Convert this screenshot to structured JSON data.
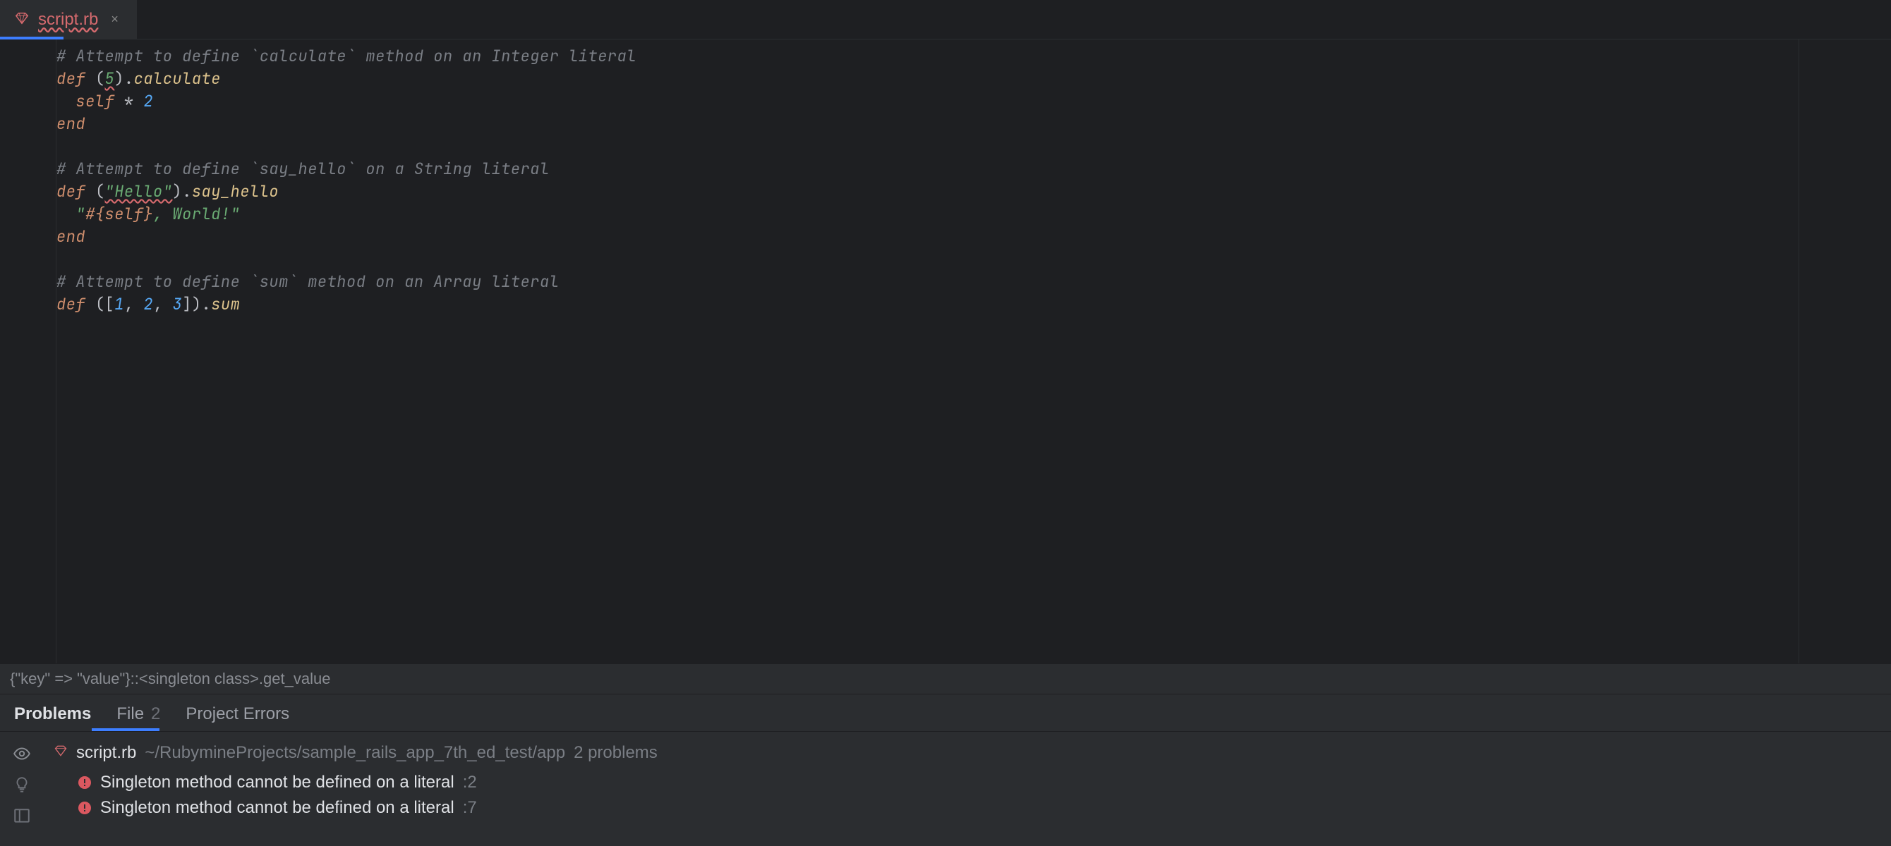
{
  "tab": {
    "filename": "script.rb"
  },
  "code": {
    "lines": [
      {
        "type": "comment",
        "text": "# Attempt to define `calculate` method on an Integer literal"
      },
      {
        "type": "def_int",
        "kw": "def",
        "lparen": "(",
        "num": "5",
        "rparen": ")",
        "dot": ".",
        "method": "calculate"
      },
      {
        "type": "self_mul",
        "self": "self",
        "op": " * ",
        "val": "2"
      },
      {
        "type": "end",
        "text": "end"
      },
      {
        "type": "blank"
      },
      {
        "type": "comment",
        "text": "# Attempt to define `say_hello` on a String literal"
      },
      {
        "type": "def_str",
        "kw": "def",
        "lparen": "(",
        "str": "\"Hello\"",
        "rparen": ")",
        "dot": ".",
        "method": "say_hello"
      },
      {
        "type": "interp",
        "q1": "\"",
        "hash": "#{",
        "self": "self",
        "rb": "}",
        "rest": ", World!\""
      },
      {
        "type": "end",
        "text": "end"
      },
      {
        "type": "blank"
      },
      {
        "type": "comment",
        "text": "# Attempt to define `sum` method on an Array literal"
      },
      {
        "type": "def_arr",
        "kw": "def",
        "lparen": "(",
        "lb": "[",
        "a": "1",
        "c1": ", ",
        "b": "2",
        "c2": ", ",
        "c": "3",
        "rb": "]",
        "rparen": ")",
        "dot": ".",
        "method": "sum"
      }
    ]
  },
  "breadcrumb": {
    "text": "{\"key\" => \"value\"}::<singleton class>.get_value"
  },
  "problems": {
    "tabs": {
      "problems": "Problems",
      "file": "File",
      "file_count": "2",
      "project_errors": "Project Errors"
    },
    "file": {
      "name": "script.rb",
      "path": "~/RubymineProjects/sample_rails_app_7th_ed_test/app",
      "count": "2 problems"
    },
    "items": [
      {
        "msg": "Singleton method cannot be defined on a literal",
        "line": ":2"
      },
      {
        "msg": "Singleton method cannot be defined on a literal",
        "line": ":7"
      }
    ]
  }
}
